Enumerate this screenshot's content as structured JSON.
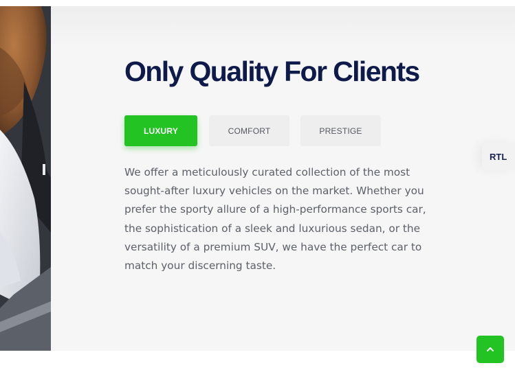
{
  "section": {
    "heading": "Only Quality For Clients",
    "tabs": [
      {
        "label": "LUXURY",
        "active": true
      },
      {
        "label": "COMFORT",
        "active": false
      },
      {
        "label": "PRESTIGE",
        "active": false
      }
    ],
    "description": "We offer a meticulously curated collection of the most sought-after luxury vehicles on the market. Whether you prefer the sporty allure of a high-performance sports car, the sophistication of a sleek and luxurious sedan, or the versatility of a premium SUV, we have the perfect car to match your discerning taste."
  },
  "rtl_toggle": {
    "label": "RTL"
  },
  "scroll_top": {
    "icon": "chevron-up-icon"
  },
  "colors": {
    "accent_green": "#22c322",
    "heading_navy": "#0d1a4a",
    "section_bg": "#f6f6f7"
  }
}
